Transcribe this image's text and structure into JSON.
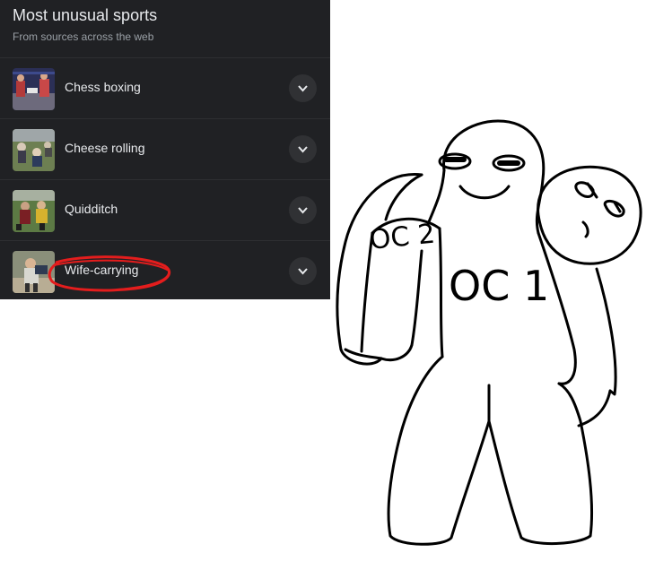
{
  "panel": {
    "title": "Most unusual sports",
    "subtitle": "From sources across the web",
    "items": [
      {
        "label": "Chess boxing",
        "thumb_icon": "chess-boxing-photo"
      },
      {
        "label": "Cheese rolling",
        "thumb_icon": "cheese-rolling-photo"
      },
      {
        "label": "Quidditch",
        "thumb_icon": "quidditch-photo"
      },
      {
        "label": "Wife-carrying",
        "thumb_icon": "wife-carrying-photo"
      }
    ]
  },
  "drawing": {
    "front_label": "OC 1",
    "back_label": "OC 2"
  },
  "colors": {
    "panel_bg": "#202124",
    "text_primary": "#e8eaed",
    "text_secondary": "#9aa0a6",
    "annotation_red": "#e41d1d"
  }
}
